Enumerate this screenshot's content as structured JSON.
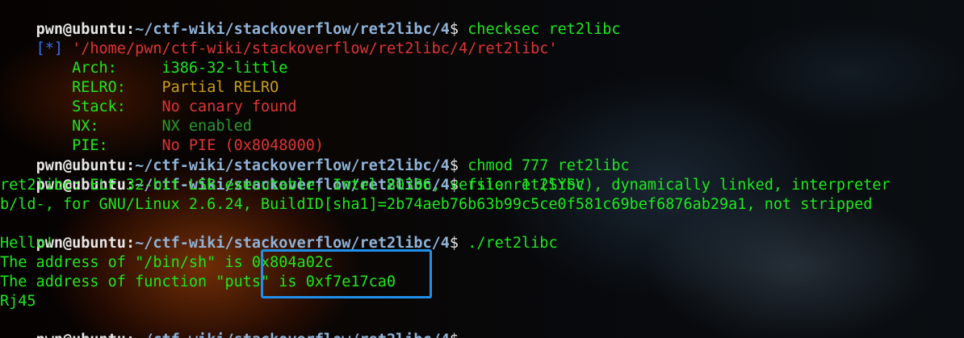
{
  "prompt": {
    "user": "pwn@ubuntu",
    "path": "~/ctf-wiki/stackoverflow/ret2libc/4",
    "dollar": "$"
  },
  "lines": {
    "l1_cmd": " checksec ret2libc",
    "l2_tag": "[*]",
    "l2_path": " '/home/pwn/ctf-wiki/stackoverflow/ret2libc/4/ret2libc'",
    "checksec": {
      "arch_key": "    Arch:     ",
      "arch_val": "i386-32-little",
      "relro_key": "    RELRO:    ",
      "relro_val": "Partial RELRO",
      "stack_key": "    Stack:    ",
      "stack_val": "No canary found",
      "nx_key": "    NX:       ",
      "nx_val": "NX enabled",
      "pie_key": "    PIE:      ",
      "pie_val": "No PIE (0x8048000)"
    },
    "l8_cmd": " chmod 777 ret2libc",
    "l9_cmd": " file ret2libc",
    "file_out_1": "ret2libc: ELF 32-bit LSB executable, Intel 80386, version 1 (SYSV), dynamically linked, interpreter",
    "file_out_2": "b/ld-, for GNU/Linux 2.6.24, BuildID[sha1]=2b74aeb76b63b99c5ce0f581c69bef6876ab29a1, not stripped",
    "l12_cmd": " ./ret2libc",
    "out_hello": "Hello!",
    "out_binsh": "The address of \"/bin/sh\" is 0x804a02c",
    "out_puts": "The address of function \"puts\" is 0xf7e17ca0",
    "out_input": "Rj45",
    "l17_cmd": ""
  },
  "colors": {
    "text_green": "#1de81d",
    "prompt_user": "#e6e6e6",
    "prompt_path": "#8fb3d9",
    "error_red": "#e03434",
    "warn_yellow": "#c8a018",
    "info_blue": "#3a6ff0",
    "highlight_box": "#1e8fea"
  }
}
